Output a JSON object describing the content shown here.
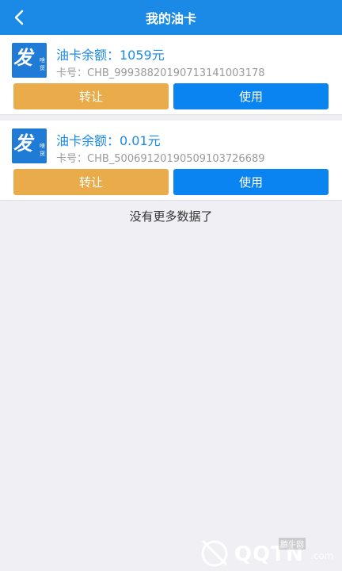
{
  "header": {
    "title": "我的油卡",
    "back_icon": "chevron-left-icon"
  },
  "cards": [
    {
      "logo": {
        "big": "发",
        "small_top": "啥",
        "small_bottom": "货"
      },
      "balance": "油卡余额：1059元",
      "card_no": "卡号：CHB_99938820190713141003178",
      "transfer_label": "转让",
      "use_label": "使用"
    },
    {
      "logo": {
        "big": "发",
        "small_top": "啥",
        "small_bottom": "货"
      },
      "balance": "油卡余额：0.01元",
      "card_no": "卡号：CHB_50069120190509103726689",
      "transfer_label": "转让",
      "use_label": "使用"
    }
  ],
  "footer": {
    "no_more": "没有更多数据了"
  },
  "watermark": {
    "brand": "QQTN",
    "suffix": ".com",
    "cn": "腾牛网"
  },
  "colors": {
    "header": "#1b8ae6",
    "transfer": "#eaac4b",
    "use": "#0a84f0",
    "accent": "#1b8ae6"
  }
}
